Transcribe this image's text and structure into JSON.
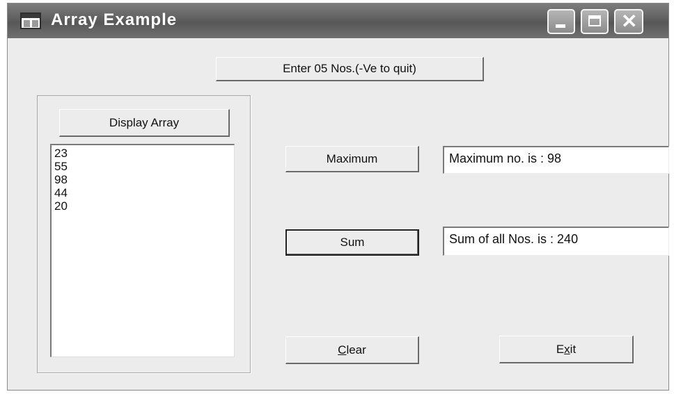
{
  "window": {
    "title": "Array Example",
    "controls": {
      "minimize": "minimize-icon",
      "maximize": "maximize-icon",
      "close": "close-icon"
    }
  },
  "form": {
    "enter_button": "Enter 05 Nos.(-Ve to quit)",
    "display_button": "Display Array",
    "array_items": [
      "23",
      "55",
      "98",
      "44",
      "20"
    ],
    "maximum_button": "Maximum",
    "maximum_result": "Maximum no. is : 98",
    "sum_button": "Sum",
    "sum_result": "Sum of all Nos. is : 240",
    "clear_button": {
      "mnemonic": "C",
      "rest": "lear"
    },
    "exit_button": {
      "before": "E",
      "mnemonic": "x",
      "after": "it"
    }
  },
  "colors": {
    "titlebar": "#5f5f5f",
    "window_bg": "#ececec",
    "field_bg": "#ffffff"
  }
}
